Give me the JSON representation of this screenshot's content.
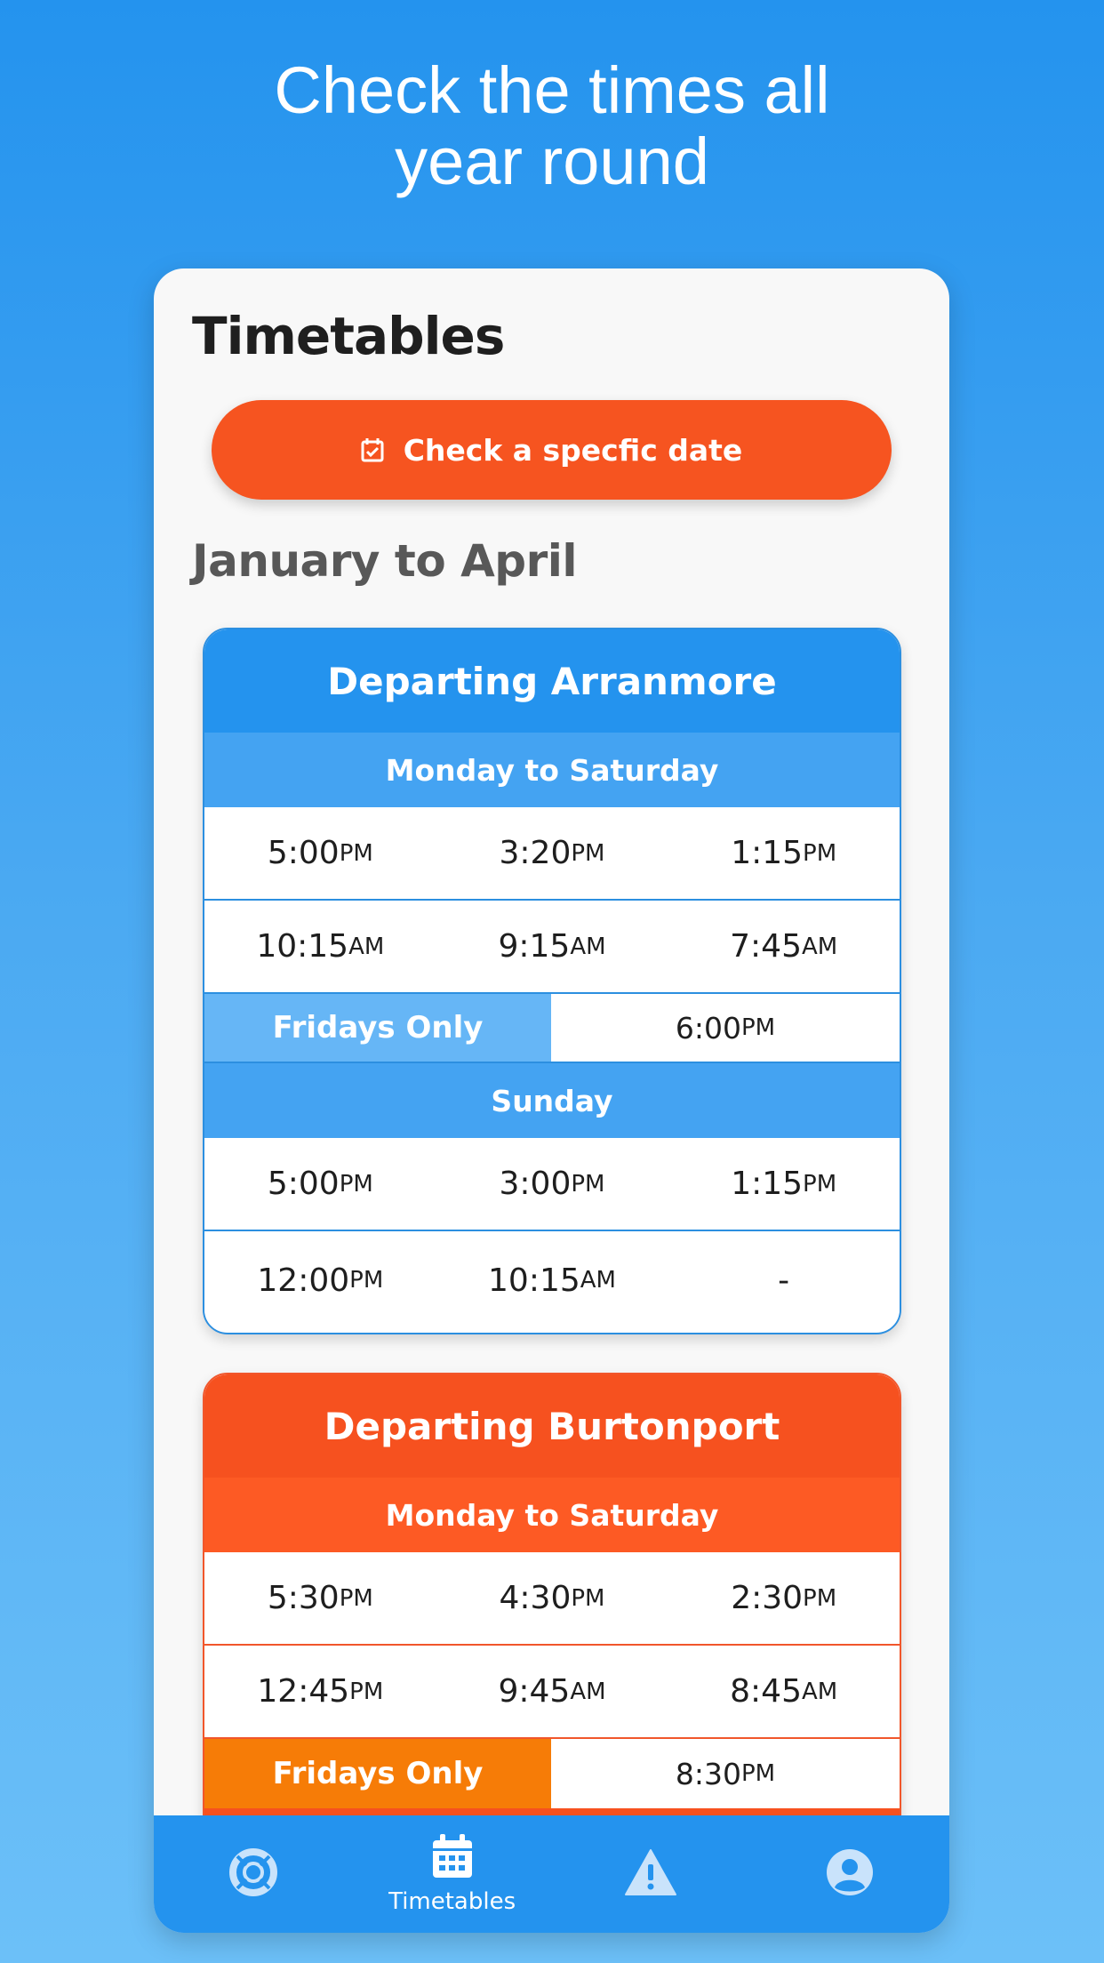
{
  "headline": {
    "line1": "Check the times all",
    "line2": "year round"
  },
  "page": {
    "title": "Timetables",
    "date_button": "Check a specfic date",
    "section": "January to April"
  },
  "arranmore": {
    "title": "Departing Arranmore",
    "weekday_label": "Monday to Saturday",
    "weekday_rows": [
      [
        {
          "t": "5:00",
          "s": "PM"
        },
        {
          "t": "3:20",
          "s": "PM"
        },
        {
          "t": "1:15",
          "s": "PM"
        }
      ],
      [
        {
          "t": "10:15",
          "s": "AM"
        },
        {
          "t": "9:15",
          "s": "AM"
        },
        {
          "t": "7:45",
          "s": "AM"
        }
      ]
    ],
    "friday_label": "Fridays Only",
    "friday_time": {
      "t": "6:00",
      "s": "PM"
    },
    "sunday_label": "Sunday",
    "sunday_rows": [
      [
        {
          "t": "5:00",
          "s": "PM"
        },
        {
          "t": "3:00",
          "s": "PM"
        },
        {
          "t": "1:15",
          "s": "PM"
        }
      ],
      [
        {
          "t": "12:00",
          "s": "PM"
        },
        {
          "t": "10:15",
          "s": "AM"
        },
        {
          "t": "-",
          "s": ""
        }
      ]
    ]
  },
  "burtonport": {
    "title": "Departing Burtonport",
    "weekday_label": "Monday to Saturday",
    "weekday_rows": [
      [
        {
          "t": "5:30",
          "s": "PM"
        },
        {
          "t": "4:30",
          "s": "PM"
        },
        {
          "t": "2:30",
          "s": "PM"
        }
      ],
      [
        {
          "t": "12:45",
          "s": "PM"
        },
        {
          "t": "9:45",
          "s": "AM"
        },
        {
          "t": "8:45",
          "s": "AM"
        }
      ]
    ],
    "friday_label": "Fridays Only",
    "friday_time": {
      "t": "8:30",
      "s": "PM"
    }
  },
  "tabbar": {
    "tabs": [
      {
        "icon": "lifebuoy-icon",
        "label": ""
      },
      {
        "icon": "calendar-icon",
        "label": "Timetables",
        "active": true
      },
      {
        "icon": "warning-icon",
        "label": ""
      },
      {
        "icon": "user-icon",
        "label": ""
      }
    ]
  },
  "colors": {
    "blue": "#2493ee",
    "orange": "#f6511f",
    "friday_orange": "#f67c07"
  }
}
